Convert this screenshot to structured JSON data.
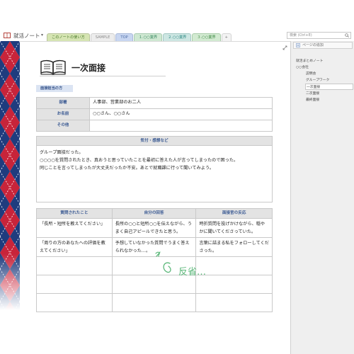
{
  "notebook": {
    "title": "就活ノート",
    "search_placeholder": "検索 (Ctrl+E)"
  },
  "tabs": [
    "このノートの使い方",
    "SAMPLE",
    "TOP",
    "１.○○業界",
    "２.○○業界",
    "３.○○業界",
    "+"
  ],
  "page": {
    "title": "一次面接",
    "section_label": "面接担当の方",
    "interviewer": {
      "rows": [
        {
          "label": "部署",
          "value": "人事部、営業部のお二人"
        },
        {
          "label": "お名前",
          "value": "○○さん、○○さん"
        },
        {
          "label": "その他",
          "value": ""
        }
      ]
    },
    "impressions": {
      "header": "気付・感想など",
      "lines": [
        "グループ面接だった。",
        "○○○○を質問されたとき、真おうと思っていたことを最初に答えた人が言ってしまったので困った。",
        "同じことを言ってしまったが大丈夫だったか不安。あとで就職課に行って聞いてみよう。"
      ]
    },
    "qa": {
      "headers": [
        "質問されたこと",
        "自分の回答",
        "面接官の反応"
      ],
      "rows": [
        [
          "「長所・短所を教えてください」",
          "長所の○○と短所○○を伝えながら、うまく自己アピールできたと思う。",
          "時折質問を投げかけながら、穏やかに聞いてくださっていた。"
        ],
        [
          "「周りの方のあなたへの評価を教えてください」",
          "予想していなかった質問でうまく答えられなかった…。",
          "言葉に詰まる私をフォローしてくださった。"
        ]
      ],
      "empty_rows": 3
    },
    "annotation": "反省…"
  },
  "sidebar": {
    "add_page": "ページの追加",
    "items": [
      "就活まとめノート",
      "○○会社",
      "説明会",
      "グループワーク",
      "一次面接",
      "二次面接",
      "最終面接"
    ]
  },
  "colors": {
    "strip_red": "#c8243a",
    "strip_navy": "#1f3c7e",
    "header_blue": "#3b5a93",
    "annotation_green": "#5cb87a"
  }
}
